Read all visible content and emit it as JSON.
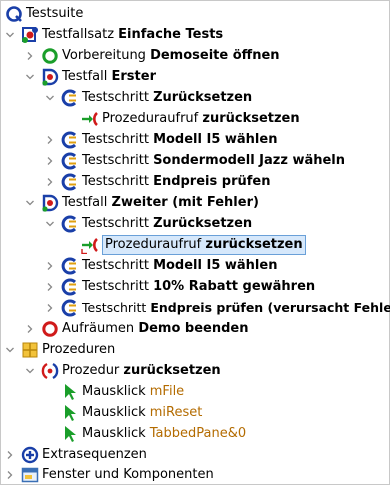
{
  "tree": {
    "root": {
      "label": "Testsuite"
    },
    "suite": {
      "prefix": "Testfallsatz",
      "name": "Einfache Tests"
    },
    "setup": {
      "prefix": "Vorbereitung",
      "name": "Demoseite öffnen"
    },
    "case1": {
      "prefix": "Testfall",
      "name": "Erster"
    },
    "c1_step1": {
      "prefix": "Testschritt",
      "name": "Zurücksetzen"
    },
    "c1_call1": {
      "prefix": "Prozeduraufruf",
      "name": "zurücksetzen"
    },
    "c1_step2": {
      "prefix": "Testschritt",
      "name": "Modell I5 wählen"
    },
    "c1_step3": {
      "prefix": "Testschritt",
      "name": "Sondermodell Jazz wäheln"
    },
    "c1_step4": {
      "prefix": "Testschritt",
      "name": "Endpreis prüfen"
    },
    "case2": {
      "prefix": "Testfall",
      "name": "Zweiter (mit Fehler)"
    },
    "c2_step1": {
      "prefix": "Testschritt",
      "name": "Zurücksetzen"
    },
    "c2_call1": {
      "prefix": "Prozeduraufruf",
      "name": "zurücksetzen"
    },
    "c2_step2": {
      "prefix": "Testschritt",
      "name": "Modell I5 wählen"
    },
    "c2_step3": {
      "prefix": "Testschritt",
      "name": "10% Rabatt gewähren"
    },
    "c2_step4": {
      "prefix": "Testschritt",
      "name": "Endpreis prüfen (verursacht Fehler)"
    },
    "cleanup": {
      "prefix": "Aufräumen",
      "name": "Demo beenden"
    },
    "procedures": {
      "label": "Prozeduren"
    },
    "proc": {
      "prefix": "Prozedur",
      "name": "zurücksetzen"
    },
    "click1": {
      "prefix": "Mausklick",
      "target": "mFile"
    },
    "click2": {
      "prefix": "Mausklick",
      "target": "miReset"
    },
    "click3": {
      "prefix": "Mausklick",
      "target": "TabbedPane&0"
    },
    "extras": {
      "label": "Extrasequenzen"
    },
    "windows": {
      "label": "Fenster und Komponenten"
    }
  },
  "colors": {
    "selection_bg": "#d6e8fb",
    "selection_border": "#6aa0d8",
    "component_text": "#b36b00",
    "testcase_blue": "#1a3fa8",
    "green": "#1a9e2a",
    "red": "#d01a1a"
  }
}
